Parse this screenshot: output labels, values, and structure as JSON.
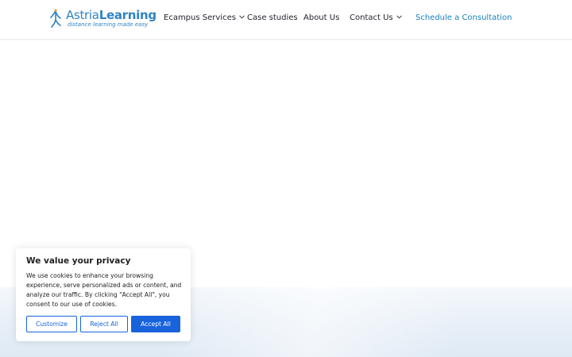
{
  "header": {
    "logo": {
      "name_part1": "Astria",
      "name_part2": "Learning",
      "tagline": "distance learning made easy",
      "brand_color": "#2f84c5"
    },
    "nav": {
      "services": "Ecampus Services",
      "case_studies": "Case studies",
      "about": "About Us",
      "contact": "Contact Us",
      "cta": "Schedule a Consultation"
    },
    "cta_color": "#1a7fc1"
  },
  "cookie_banner": {
    "title": "We value your privacy",
    "body": "We use cookies to enhance your browsing experience, serve personalized ads or content, and analyze our traffic. By clicking \"Accept All\", you consent to our use of cookies.",
    "buttons": {
      "customize": "Customize",
      "reject": "Reject All",
      "accept": "Accept All"
    },
    "accent_color": "#1863dc"
  },
  "icons": {
    "logo_mark": "figure-icon",
    "dropdown": "chevron-down-icon"
  }
}
